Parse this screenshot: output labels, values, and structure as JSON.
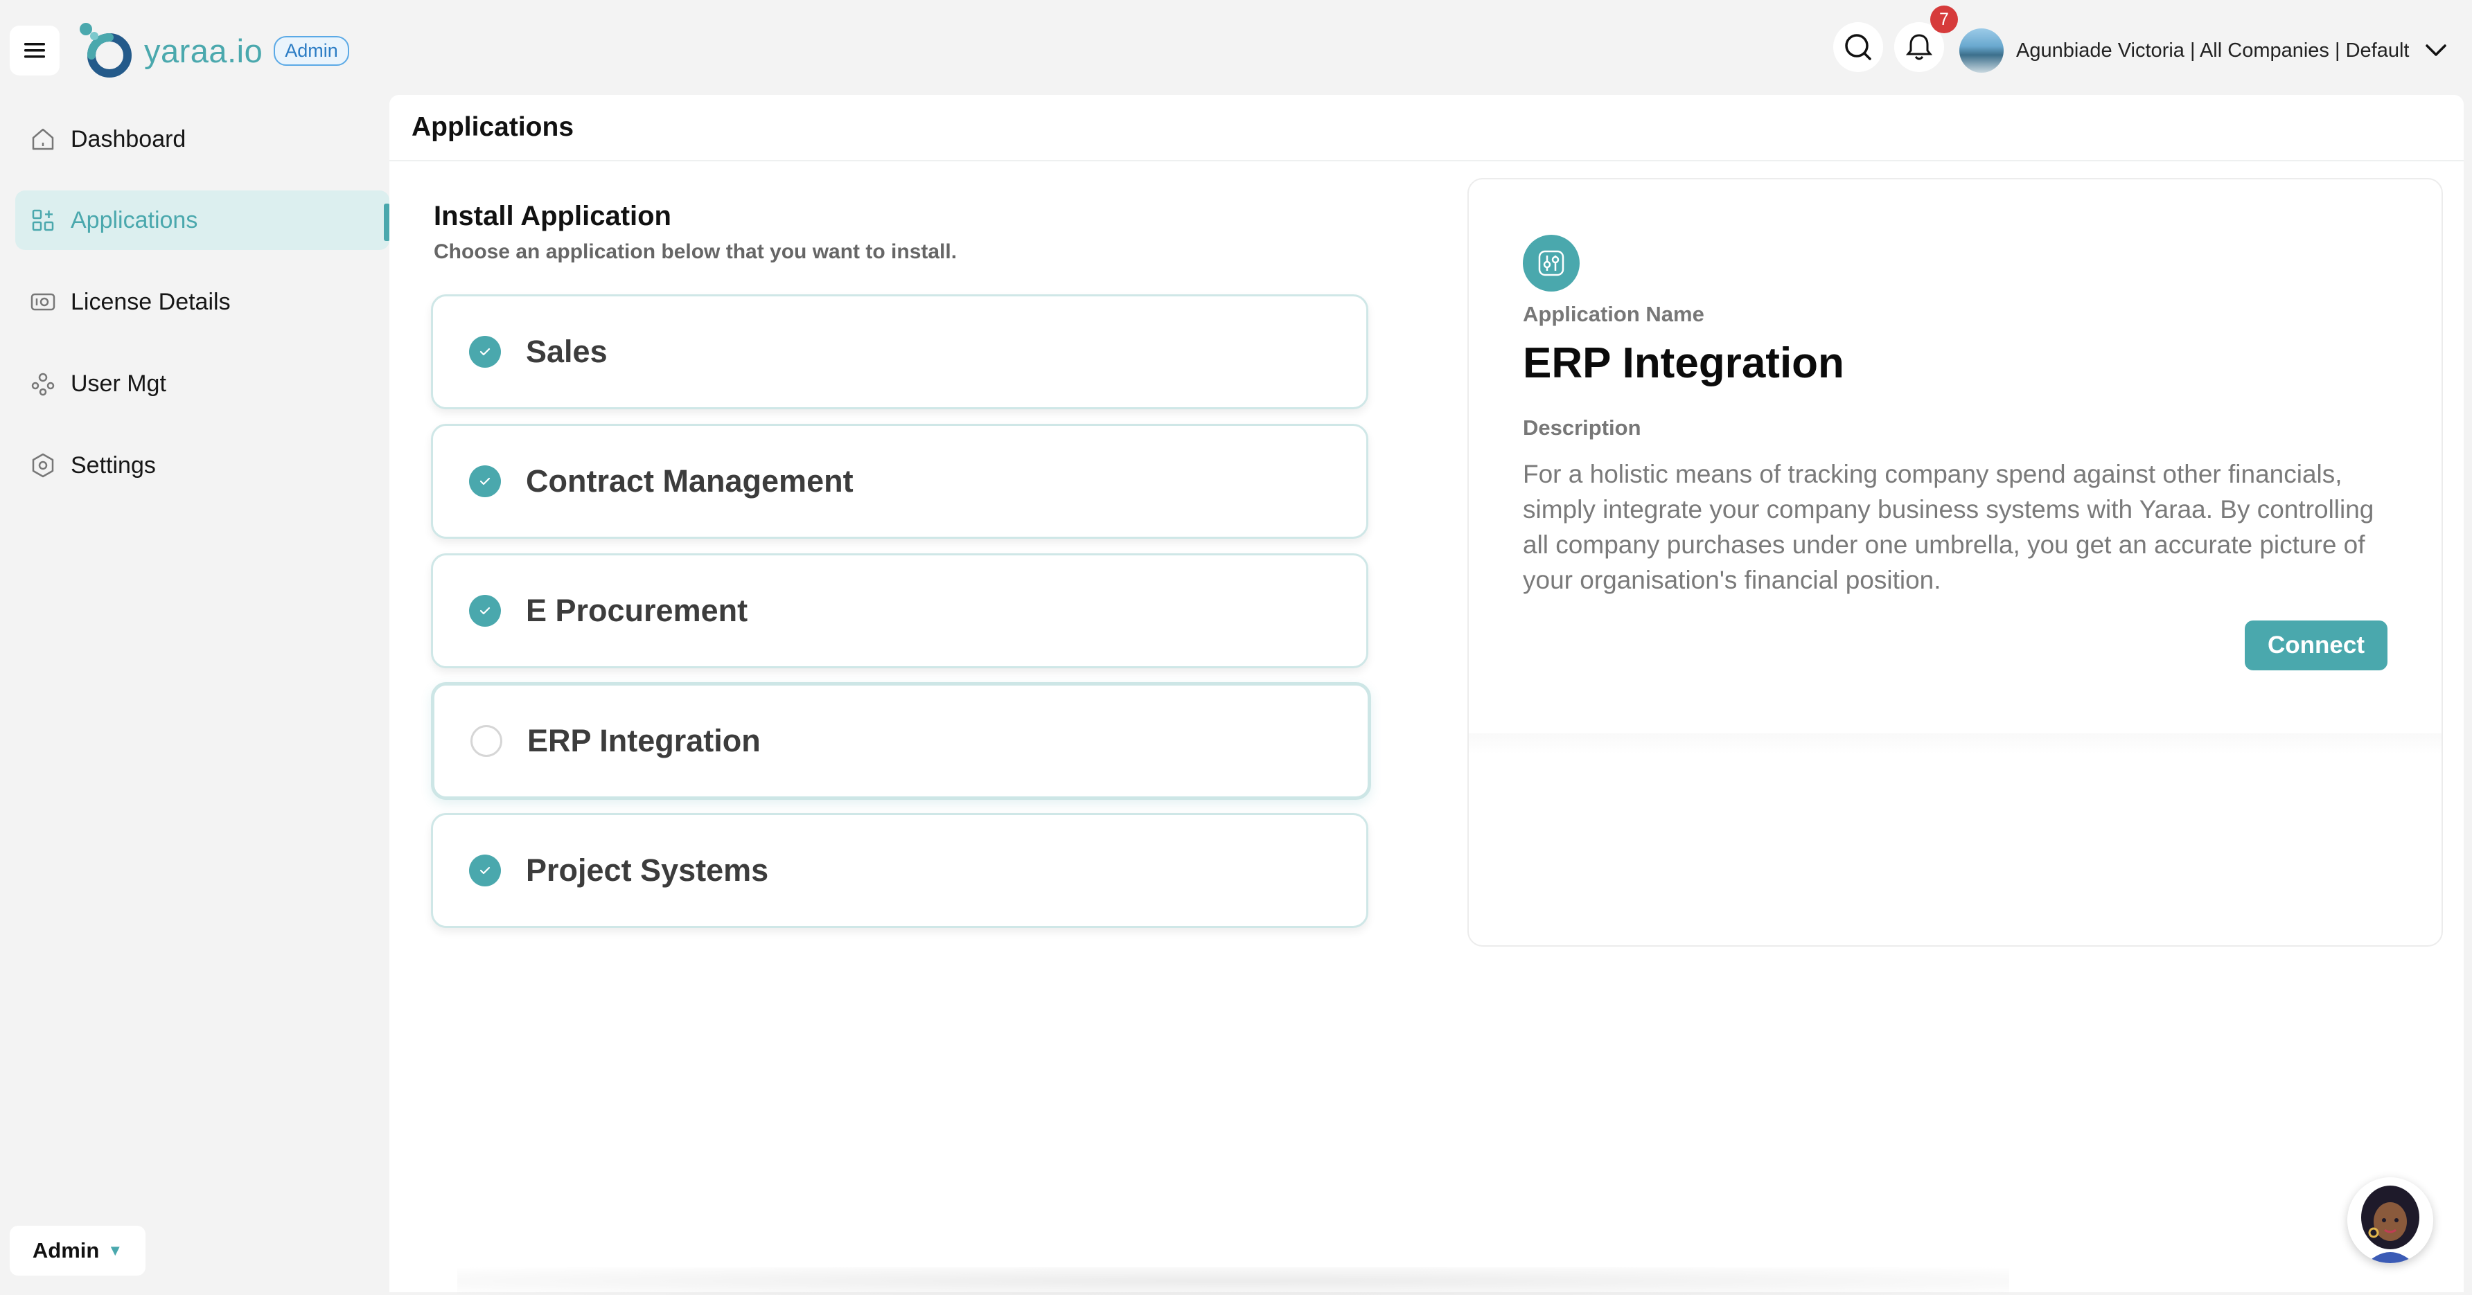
{
  "brand": {
    "name": "yaraa.io",
    "role_badge": "Admin",
    "accent": "#4aa8ad"
  },
  "header": {
    "notification_count": "7",
    "user_label": "Agunbiade Victoria | All Companies | Default",
    "icons": [
      "menu-icon",
      "search-icon",
      "bell-icon",
      "chevron-down-icon"
    ]
  },
  "sidebar": {
    "items": [
      {
        "label": "Dashboard",
        "icon": "home-icon"
      },
      {
        "label": "Applications",
        "icon": "apps-icon",
        "active": true
      },
      {
        "label": "License Details",
        "icon": "license-icon"
      },
      {
        "label": "User Mgt",
        "icon": "users-icon"
      },
      {
        "label": "Settings",
        "icon": "gear-icon"
      }
    ],
    "role_switcher": "Admin"
  },
  "main": {
    "page_title": "Applications",
    "install_title": "Install Application",
    "install_subtitle": "Choose an application below that you want to install.",
    "apps": [
      {
        "name": "Sales",
        "checked": true
      },
      {
        "name": "Contract Management",
        "checked": true
      },
      {
        "name": "E Procurement",
        "checked": true
      },
      {
        "name": "ERP Integration",
        "checked": false,
        "selected": true
      },
      {
        "name": "Project Systems",
        "checked": true
      }
    ],
    "detail": {
      "name_label": "Application Name",
      "name": "ERP Integration",
      "description_label": "Description",
      "description": "For a holistic means of tracking company spend against other financials, simply integrate your company business systems with Yaraa. By controlling all company purchases under one umbrella, you get an accurate picture of your organisation's financial position.",
      "connect_label": "Connect"
    }
  }
}
